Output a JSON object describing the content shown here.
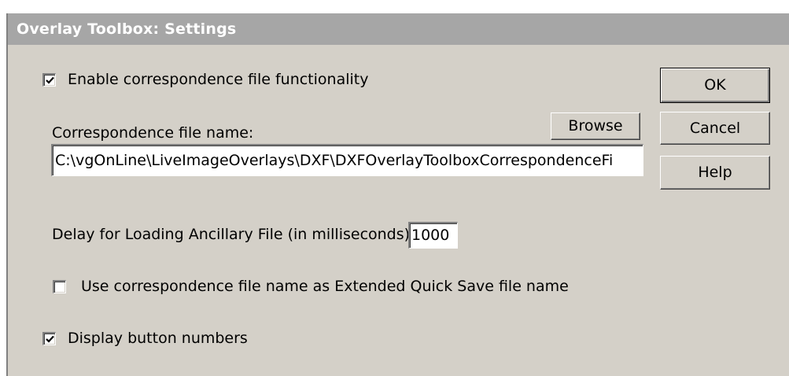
{
  "dialog": {
    "title": "Overlay Toolbox: Settings"
  },
  "enable_correspondence": {
    "label": "Enable correspondence file functionality",
    "checked": true
  },
  "correspondence_file": {
    "label": "Correspondence file name:",
    "value": "C:\\vgOnLine\\LiveImageOverlays\\DXF\\DXFOverlayToolboxCorrespondenceFi",
    "browse_label": "Browse"
  },
  "delay": {
    "label": "Delay for Loading Ancillary File (in milliseconds):",
    "value": "1000"
  },
  "quick_save": {
    "label": "Use correspondence file name as Extended Quick Save file name",
    "checked": false
  },
  "display_numbers": {
    "label": "Display button numbers",
    "checked": true
  },
  "buttons": {
    "ok": "OK",
    "cancel": "Cancel",
    "help": "Help"
  },
  "colors": {
    "dialog_bg": "#d4d0c8",
    "titlebar_bg": "#a6a6a6",
    "titlebar_text": "#ffffff"
  },
  "icons": {
    "checkmark": "check-icon"
  }
}
